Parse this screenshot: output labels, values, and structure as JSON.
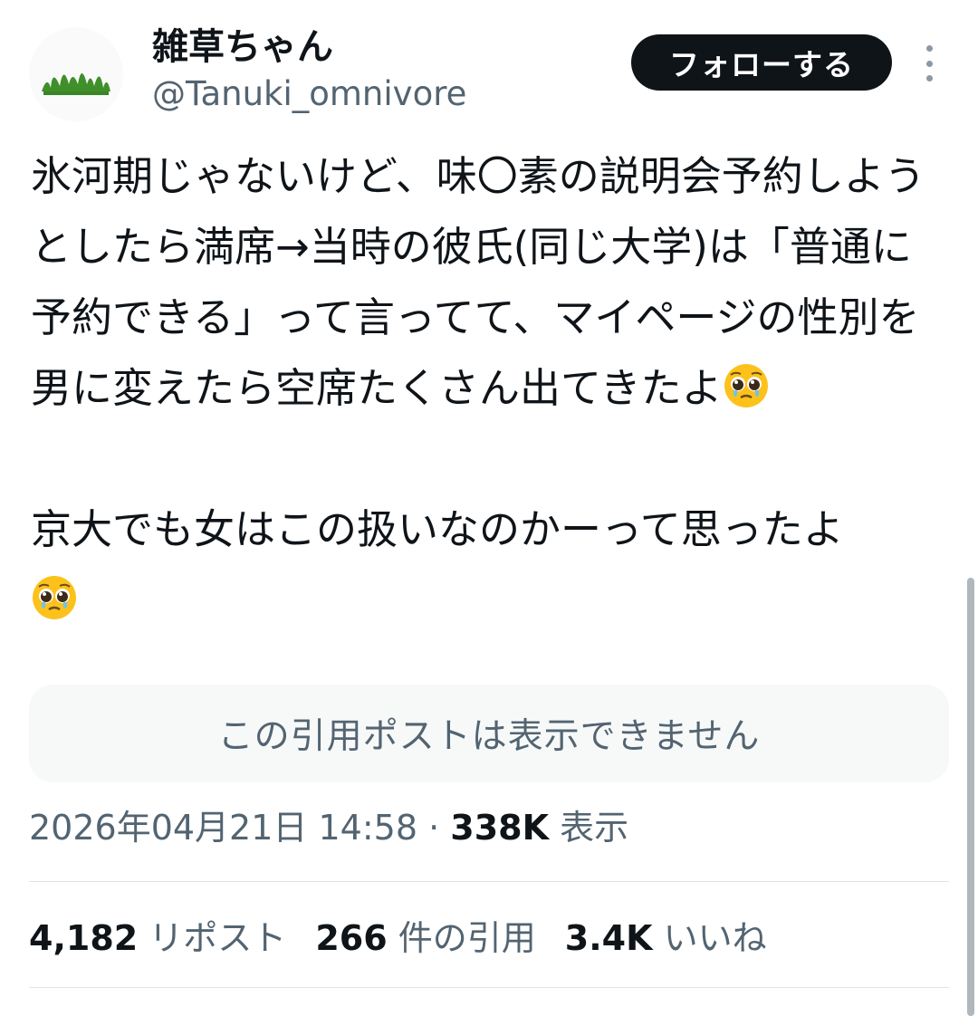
{
  "author": {
    "name": "雑草ちゃん",
    "handle": "@Tanuki_omnivore",
    "avatar_icon": "grass-icon"
  },
  "follow_button": {
    "label": "フォローする"
  },
  "more_icon": "more-vertical-icon",
  "post": {
    "paragraph1": "氷河期じゃないけど、味〇素の説明会予約しようとしたら満席→当時の彼氏(同じ大学)は「普通に予約できる」って言ってて、マイページの性別を男に変えたら空席たくさん出てきたよ",
    "paragraph2": "京大でも女はこの扱いなのかーって思ったよ",
    "emoji": "pleading-face-emoji"
  },
  "quote": {
    "text": "この引用ポストは表示できません"
  },
  "meta": {
    "timestamp": "2026年04月21日 14:58",
    "separator": "·",
    "views_count": "338K",
    "views_label": "表示"
  },
  "stats": {
    "reposts_count": "4,182",
    "reposts_label": "リポスト",
    "quotes_count": "266",
    "quotes_label": "件の引用",
    "likes_count": "3.4K",
    "likes_label": "いいね"
  },
  "colors": {
    "text_primary": "#0f1419",
    "text_secondary": "#536471",
    "follow_bg": "#0f1419",
    "quote_bg": "#f7f9f9",
    "divider": "#dfe4e8"
  }
}
